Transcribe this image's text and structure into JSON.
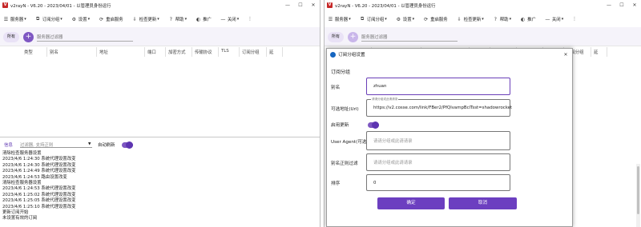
{
  "window_title": "v2rayN - V6.20 - 2023/04/01 - 以管理员身份运行",
  "window_controls": {
    "minimize": "—",
    "maximize": "☐",
    "close": "✕"
  },
  "menu": [
    {
      "label": "服务器",
      "icon": "☰",
      "caret": true
    },
    {
      "label": "订阅分组",
      "icon": "⧉",
      "caret": true
    },
    {
      "label": "设置",
      "icon": "⚙",
      "caret": true
    },
    {
      "label": "重启服务",
      "icon": "⟳",
      "caret": false
    },
    {
      "label": "检查更新",
      "icon": "⇩",
      "caret": true
    },
    {
      "label": "帮助",
      "icon": "?",
      "caret": true
    },
    {
      "label": "推广",
      "icon": "◐",
      "caret": false
    },
    {
      "label": "关闭",
      "icon": "—",
      "caret": true
    },
    {
      "label": "⋮",
      "icon": "",
      "caret": false
    }
  ],
  "filter": {
    "all_label": "所有",
    "add_label": "+",
    "placeholder": "服务器过滤器"
  },
  "columns": [
    "类型",
    "别名",
    "地址",
    "端口",
    "加密方式",
    "传输协议",
    "TLS",
    "订阅分组",
    "延"
  ],
  "log": {
    "label": "信息",
    "filter_placeholder": "过滤器, 支持正则",
    "autoscroll_label": "自动刷新",
    "lines": [
      "清除检查服务器设置",
      "2023/4/6 1:24:30 系统代理设置改变",
      "2023/4/6 1:24:30 系统代理设置改变",
      "2023/4/6 1:24:49 系统代理设置改变",
      "2023/4/6 1:24:53 路由设置改变",
      "清除检查服务器设置",
      "2023/4/6 1:24:53 系统代理设置改变",
      "2023/4/6 1:25:02 系统代理设置改变",
      "2023/4/6 1:25:05 系统代理设置改变",
      "2023/4/6 1:25:10 系统代理设置改变",
      "更新订阅开始",
      "未设置有效的订阅"
    ]
  },
  "dialog": {
    "title": "订阅分组设置",
    "section": "订阅分组",
    "remarks_label": "别名",
    "remarks_value": "zhuan",
    "url_label": "可选地址(Url)",
    "url_float": "请请分组或此请请录",
    "url_value": "https://v2.cosse.com/link/FBer2/PfQlvampBclTsst=shadowrocket",
    "enabled_label": "启用更新",
    "ua_label": "User Agent(可选)",
    "ua_placeholder": "请请分组或此请请录",
    "filter_label": "别名正则过滤",
    "filter_placeholder": "请请分组或此请请录",
    "sort_label": "排序",
    "sort_value": "0",
    "ok_label": "确定",
    "cancel_label": "取消"
  },
  "colors": {
    "accent": "#6c3fc0",
    "toggle": "#7e57c2",
    "app_icon": "#c62828"
  }
}
